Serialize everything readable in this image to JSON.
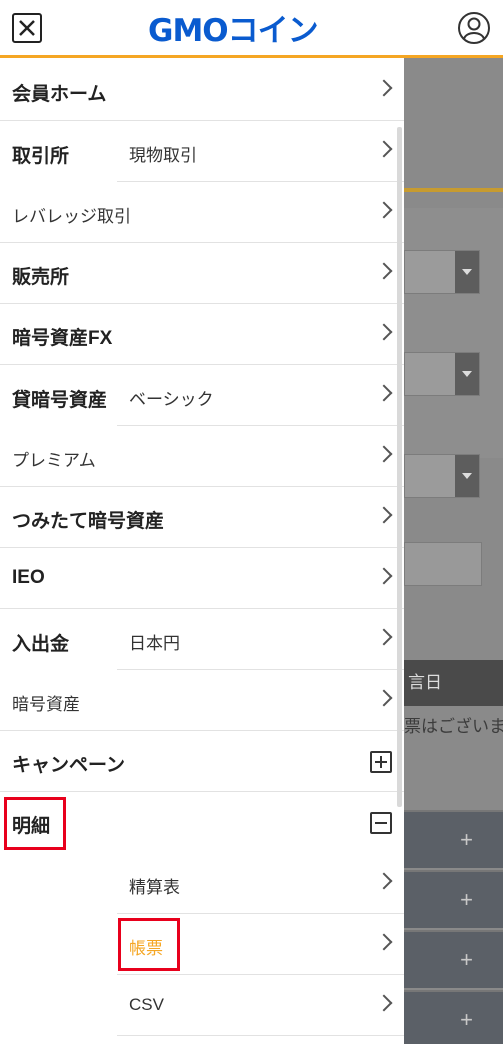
{
  "header": {
    "logo_text": "GMOコイン",
    "close_icon": "close-icon",
    "user_icon": "user-icon",
    "accent_color": "#f5a623",
    "brand_color": "#0a5bcf"
  },
  "menu": {
    "items": [
      {
        "label": "会員ホーム"
      },
      {
        "label": "取引所",
        "subs": [
          "現物取引",
          "レバレッジ取引"
        ]
      },
      {
        "label": "販売所"
      },
      {
        "label": "暗号資産FX"
      },
      {
        "label": "貸暗号資産",
        "subs": [
          "ベーシック",
          "プレミアム"
        ]
      },
      {
        "label": "つみたて暗号資産"
      },
      {
        "label": "IEO"
      },
      {
        "label": "入出金",
        "subs": [
          "日本円",
          "暗号資産"
        ]
      },
      {
        "label": "キャンペーン",
        "toggle": "expand"
      },
      {
        "label": "明細",
        "toggle": "collapse",
        "subs": [
          "精算表",
          "帳票",
          "CSV"
        ]
      }
    ]
  },
  "background": {
    "bar_text": "言日",
    "note_text": "票はございま"
  }
}
